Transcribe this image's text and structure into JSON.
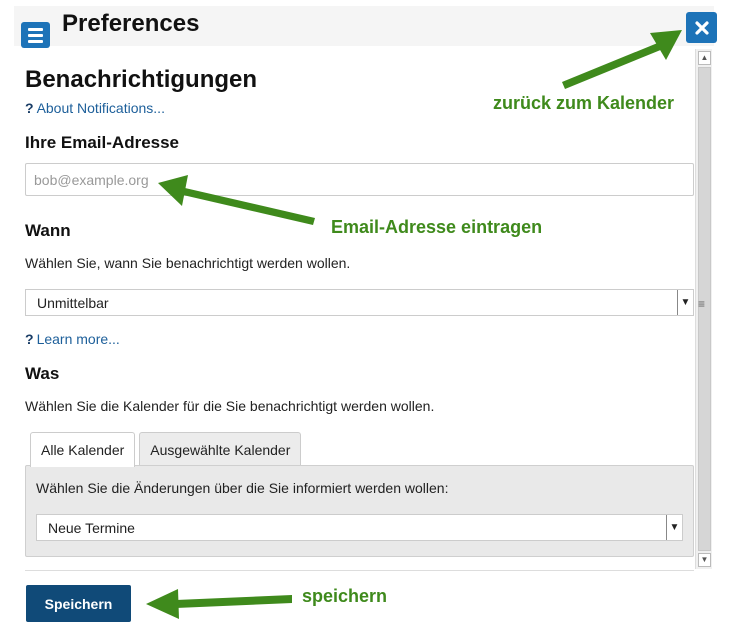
{
  "header": {
    "title": "Preferences",
    "menu_icon": "hamburger-menu-icon",
    "close_icon": "close-x-icon",
    "accent_color": "#1d73b8"
  },
  "notifications": {
    "heading": "Benachrichtigungen",
    "about_link_mark": "?",
    "about_link": "About Notifications...",
    "email_label": "Ihre Email-Adresse",
    "email_value": "",
    "email_placeholder": "bob@example.org",
    "when_label": "Wann",
    "when_description": "Wählen Sie, wann Sie benachrichtigt werden wollen.",
    "when_selected": "Unmittelbar",
    "learn_more_mark": "?",
    "learn_more_link": "Learn more...",
    "what_label": "Was",
    "what_description": "Wählen Sie die Kalender für die Sie benachrichtigt werden wollen.",
    "tabs": [
      {
        "label": "Alle Kalender",
        "active": true
      },
      {
        "label": "Ausgewählte Kalender",
        "active": false
      }
    ],
    "changes_description": "Wählen Sie die Änderungen über die Sie informiert werden wollen:",
    "changes_selected": "Neue Termine"
  },
  "footer": {
    "save_label": "Speichern",
    "save_color": "#104a78"
  },
  "annotations": {
    "back_to_calendar": "zurück zum Kalender",
    "enter_email": "Email-Adresse eintragen",
    "save": "speichern",
    "color": "#3f8a1c"
  }
}
